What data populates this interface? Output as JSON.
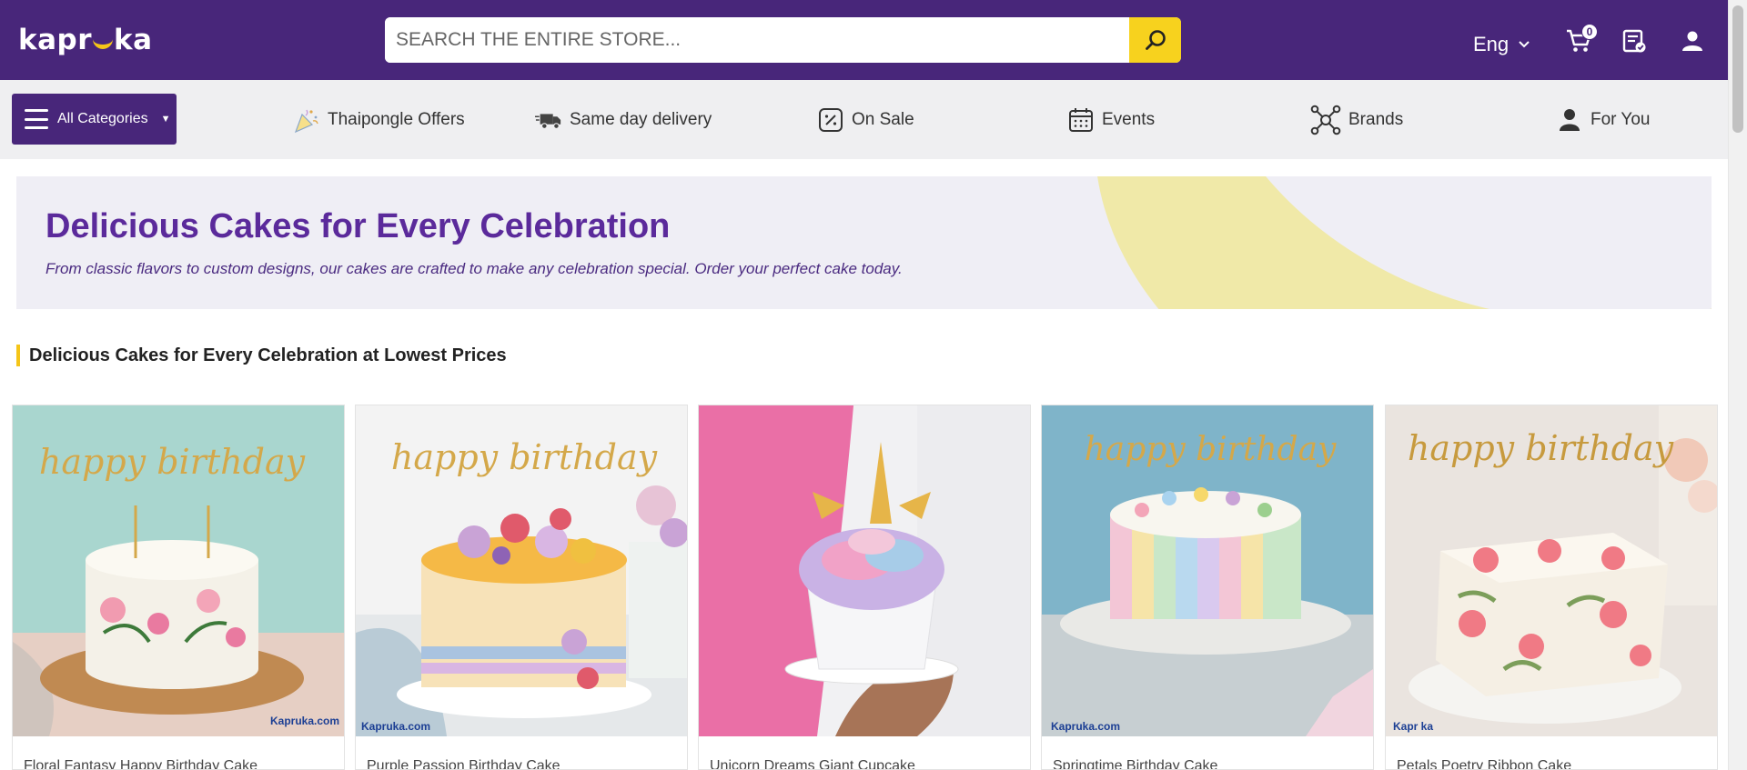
{
  "header": {
    "logo_text": "kapruka",
    "search_placeholder": "SEARCH THE ENTIRE STORE...",
    "language": "Eng",
    "cart_count": "0",
    "icons": [
      "search-icon",
      "chevron-down-icon",
      "cart-icon",
      "order-list-icon",
      "user-icon"
    ],
    "colors": {
      "header_bg": "#48267a",
      "accent": "#f7d21e"
    }
  },
  "nav": {
    "all_categories": "All Categories",
    "items": [
      {
        "label": "Thaipongle Offers",
        "icon": "party-popper-icon"
      },
      {
        "label": "Same day delivery",
        "icon": "truck-icon"
      },
      {
        "label": "On Sale",
        "icon": "percent-tag-icon"
      },
      {
        "label": "Events",
        "icon": "calendar-icon"
      },
      {
        "label": "Brands",
        "icon": "network-icon"
      },
      {
        "label": "For You",
        "icon": "person-icon"
      }
    ]
  },
  "banner": {
    "title": "Delicious Cakes for Every Celebration",
    "subtitle": "From classic flavors to custom designs, our cakes are crafted to make any celebration special. Order your perfect cake today."
  },
  "section": {
    "heading": "Delicious Cakes for Every Celebration at Lowest Prices"
  },
  "products": [
    {
      "name": "Floral Fantasy Happy Birthday Cake",
      "watermark": "Kapruka.com"
    },
    {
      "name": "Purple Passion Birthday Cake",
      "watermark": "Kapruka.com"
    },
    {
      "name": "Unicorn Dreams Giant Cupcake",
      "watermark": ""
    },
    {
      "name": "Springtime Birthday Cake",
      "watermark": "Kapruka.com"
    },
    {
      "name": "Petals Poetry Ribbon Cake",
      "watermark": "Kapr ka"
    }
  ],
  "cake_topper_text": "happy birthday"
}
